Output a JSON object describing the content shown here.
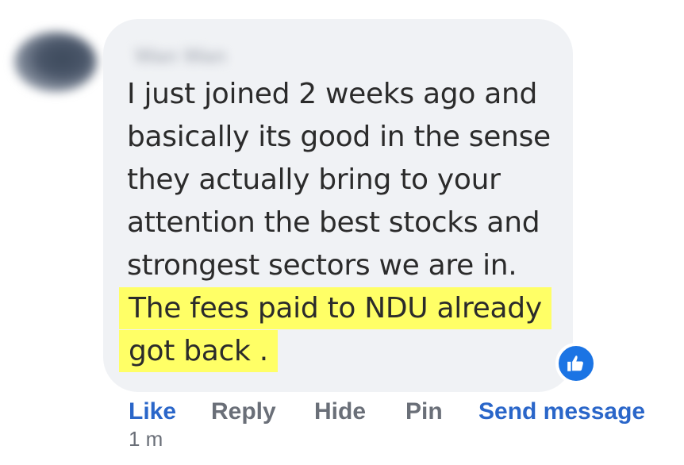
{
  "comment": {
    "author_name": "Wan Wan",
    "text_plain": "I just joined 2 weeks ago and basically its good in the sense they actually bring to your attention the best stocks and strongest sectors we are in.",
    "text_highlighted": "The fees paid to NDU already got back .",
    "highlight_color": "#ffff66",
    "bubble_color": "#f0f2f5",
    "reaction_icon": "like-thumbs-up-icon",
    "reaction_color": "#1b74e4"
  },
  "actions": {
    "like": "Like",
    "reply": "Reply",
    "hide": "Hide",
    "pin": "Pin",
    "send_message": "Send message"
  },
  "meta": {
    "timestamp": "1 m"
  }
}
